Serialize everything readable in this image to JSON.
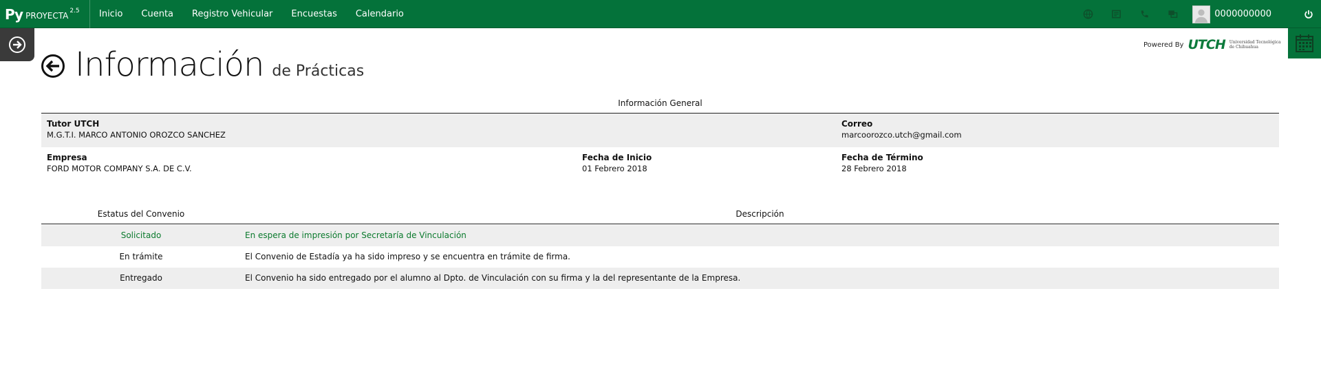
{
  "brand": {
    "short": "Py",
    "name": "PROYECTA",
    "version": "2.5"
  },
  "nav": [
    "Inicio",
    "Cuenta",
    "Registro Vehicular",
    "Encuestas",
    "Calendario"
  ],
  "user": {
    "name": "0000000000"
  },
  "powered": {
    "label": "Powered By",
    "logo": "UTCH",
    "sub1": "Universidad Tecnológica",
    "sub2": "de Chihuahua"
  },
  "title": {
    "main": "Información",
    "sub": "de Prácticas"
  },
  "general": {
    "heading": "Información General",
    "tutor_label": "Tutor UTCH",
    "tutor_value": "M.G.T.I. MARCO ANTONIO OROZCO SANCHEZ",
    "email_label": "Correo",
    "email_value": "marcoorozco.utch@gmail.com",
    "company_label": "Empresa",
    "company_value": "FORD MOTOR COMPANY S.A. DE C.V.",
    "start_label": "Fecha de Inicio",
    "start_value": "01 Febrero 2018",
    "end_label": "Fecha de Término",
    "end_value": "28 Febrero 2018"
  },
  "status": {
    "col_status": "Estatus del Convenio",
    "col_desc": "Descripción",
    "rows": [
      {
        "status": "Solicitado",
        "desc": "En espera de impresión por Secretaría de Vinculación"
      },
      {
        "status": "En trámite",
        "desc": "El Convenio de Estadía ya ha sido impreso y se encuentra en trámite de firma."
      },
      {
        "status": "Entregado",
        "desc": "El Convenio ha sido entregado por el alumno al Dpto. de Vinculación con su firma y la del representante de la Empresa."
      }
    ]
  },
  "colors": {
    "primary": "#04723a",
    "active_text": "#0b7a2d",
    "row_shade": "#eeeeee"
  }
}
